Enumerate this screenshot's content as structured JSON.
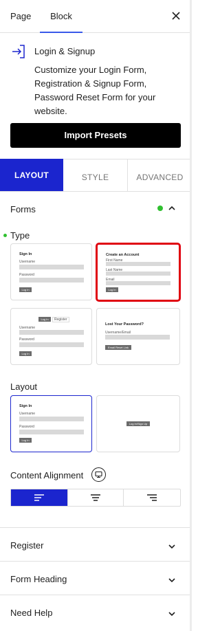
{
  "header": {
    "tab_page": "Page",
    "tab_block": "Block"
  },
  "block": {
    "title": "Login & Signup",
    "description": "Customize your Login Form, Registration & Signup Form, Password Reset Form for your website.",
    "import_label": "Import Presets"
  },
  "section_tabs": {
    "layout": "LAYOUT",
    "style": "STYLE",
    "advanced": "ADVANCED"
  },
  "forms": {
    "title": "Forms",
    "type_label": "Type",
    "signin": {
      "heading": "Sign In",
      "username": "Username",
      "password": "Password",
      "button": "Log In"
    },
    "create": {
      "heading": "Create an Account",
      "first": "First Name",
      "last": "Last Name",
      "email": "Email",
      "button": "Log In"
    },
    "tabbed": {
      "login_tab": "Log In",
      "register_tab": "Register",
      "username": "Username",
      "password": "Password",
      "button": "Log In"
    },
    "lost": {
      "heading": "Lost Your Password?",
      "field": "Username/Email",
      "button": "Email Reset Link"
    },
    "layout_label": "Layout",
    "layout_signin": {
      "heading": "Sign In",
      "username": "Username",
      "password": "Password",
      "button": "Log In"
    },
    "layout_popup_button": "Log In/Sign Up",
    "alignment_label": "Content Alignment"
  },
  "accordions": {
    "register": "Register",
    "form_heading": "Form Heading",
    "need_help": "Need Help"
  },
  "colors": {
    "accent": "#1b25ce",
    "selected_outline": "#e0000f",
    "status_green": "#30c030"
  }
}
